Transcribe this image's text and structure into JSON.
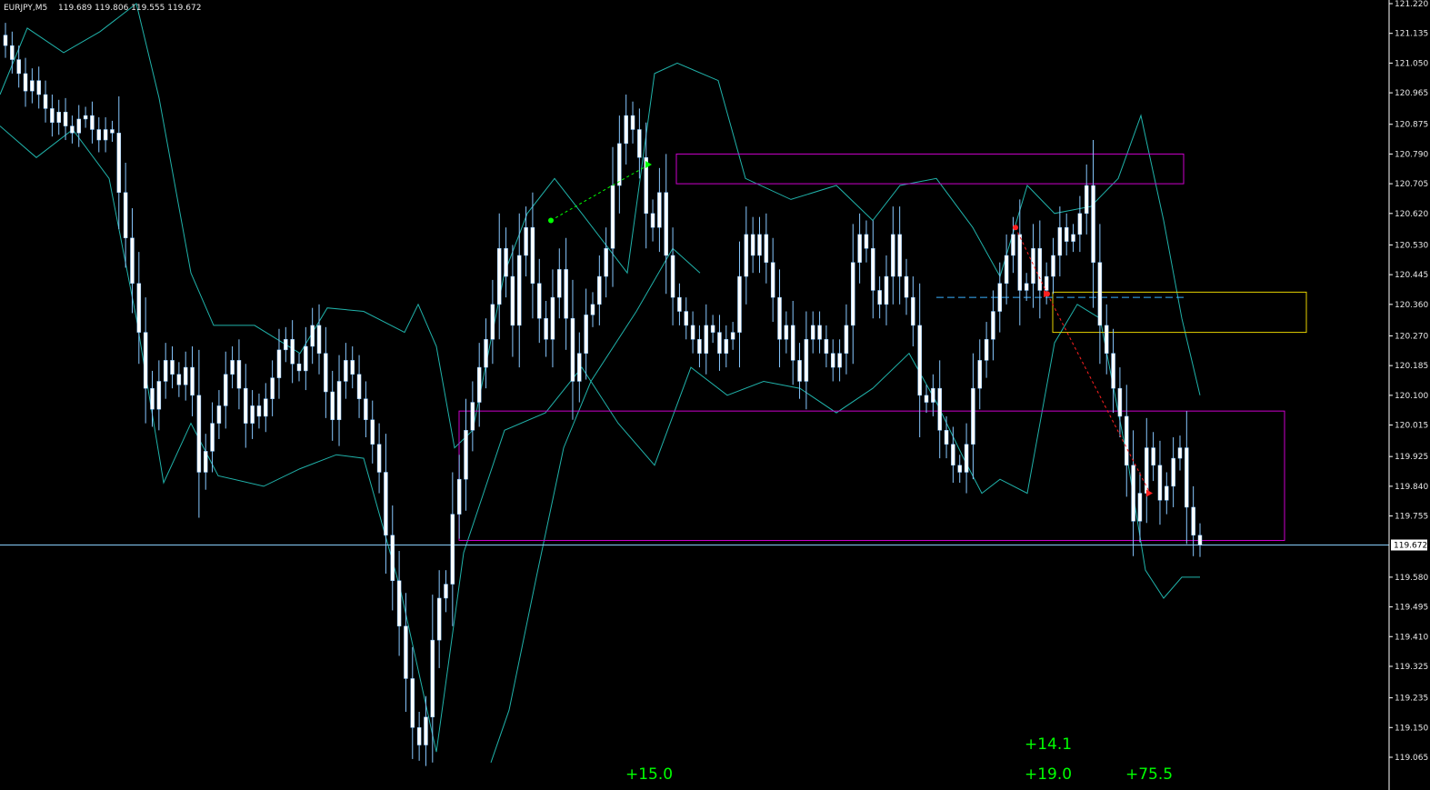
{
  "header": {
    "symbol": "EURJPY,M5",
    "ohlc": "119.689 119.806 119.555 119.672"
  },
  "colors": {
    "background": "#000000",
    "candle_up": "#ffffff",
    "candle_down": "#ffffff",
    "wick": "#87c7ff",
    "bollinger": "#20b2aa",
    "zone_magenta": "#cc00cc",
    "zone_yellow": "#e6d200",
    "trade_buy": "#00ff00",
    "trade_sell": "#ff2020",
    "current_price_line": "#87cefa",
    "profit_text": "#00ff00"
  },
  "chart_data": {
    "type": "candlestick",
    "symbol": "EURJPY",
    "timeframe": "M5",
    "yrange": [
      119.065,
      121.22
    ],
    "y_ticks": [
      "121.220",
      "121.135",
      "121.050",
      "120.965",
      "120.875",
      "120.790",
      "120.705",
      "120.620",
      "120.530",
      "120.445",
      "120.360",
      "120.270",
      "120.185",
      "120.100",
      "120.015",
      "119.925",
      "119.840",
      "119.755",
      "119.672",
      "119.580",
      "119.495",
      "119.410",
      "119.325",
      "119.235",
      "119.150",
      "119.065"
    ],
    "current_price": 119.672,
    "closes": [
      121.1,
      121.06,
      121.02,
      120.97,
      121.0,
      120.96,
      120.92,
      120.88,
      120.91,
      120.87,
      120.85,
      120.89,
      120.9,
      120.86,
      120.83,
      120.86,
      120.85,
      120.68,
      120.55,
      120.42,
      120.28,
      120.12,
      120.06,
      120.14,
      120.2,
      120.16,
      120.13,
      120.18,
      120.1,
      119.88,
      119.94,
      120.02,
      120.07,
      120.16,
      120.2,
      120.12,
      120.02,
      120.07,
      120.04,
      120.09,
      120.15,
      120.23,
      120.26,
      120.19,
      120.17,
      120.24,
      120.3,
      120.22,
      120.11,
      120.03,
      120.14,
      120.2,
      120.16,
      120.09,
      120.03,
      119.96,
      119.88,
      119.7,
      119.57,
      119.44,
      119.29,
      119.15,
      119.1,
      119.18,
      119.4,
      119.52,
      119.56,
      119.76,
      119.86,
      120.0,
      120.08,
      120.18,
      120.26,
      120.36,
      120.52,
      120.44,
      120.3,
      120.5,
      120.58,
      120.42,
      120.32,
      120.26,
      120.38,
      120.46,
      120.32,
      120.14,
      120.22,
      120.33,
      120.36,
      120.44,
      120.52,
      120.7,
      120.82,
      120.9,
      120.86,
      120.78,
      120.62,
      120.58,
      120.68,
      120.5,
      120.38,
      120.34,
      120.3,
      120.26,
      120.22,
      120.3,
      120.28,
      120.22,
      120.26,
      120.28,
      120.44,
      120.56,
      120.5,
      120.56,
      120.48,
      120.38,
      120.26,
      120.3,
      120.2,
      120.14,
      120.26,
      120.3,
      120.26,
      120.22,
      120.18,
      120.22,
      120.3,
      120.48,
      120.56,
      120.52,
      120.4,
      120.36,
      120.44,
      120.56,
      120.44,
      120.38,
      120.3,
      120.1,
      120.08,
      120.12,
      120.0,
      119.96,
      119.9,
      119.88,
      119.96,
      120.12,
      120.2,
      120.26,
      120.34,
      120.42,
      120.5,
      120.56,
      120.4,
      120.42,
      120.52,
      120.4,
      120.44,
      120.5,
      120.58,
      120.54,
      120.56,
      120.62,
      120.7,
      120.48,
      120.3,
      120.22,
      120.12,
      120.04,
      119.9,
      119.74,
      119.82,
      119.95,
      119.9,
      119.8,
      119.84,
      119.92,
      119.95,
      119.78,
      119.7,
      119.672
    ]
  },
  "bollinger": {
    "upper": [
      [
        0,
        120.96
      ],
      [
        30,
        121.15
      ],
      [
        70,
        121.08
      ],
      [
        110,
        121.14
      ],
      [
        150,
        121.22
      ],
      [
        175,
        120.95
      ],
      [
        210,
        120.45
      ],
      [
        235,
        120.3
      ],
      [
        280,
        120.3
      ],
      [
        330,
        120.22
      ],
      [
        360,
        120.35
      ],
      [
        400,
        120.34
      ],
      [
        445,
        120.28
      ],
      [
        460,
        120.36
      ],
      [
        480,
        120.24
      ],
      [
        500,
        119.95
      ],
      [
        520,
        120.0
      ],
      [
        555,
        120.45
      ],
      [
        580,
        120.62
      ],
      [
        610,
        120.72
      ],
      [
        640,
        120.62
      ],
      [
        690,
        120.45
      ],
      [
        720,
        121.02
      ],
      [
        745,
        121.05
      ],
      [
        790,
        121.0
      ],
      [
        820,
        120.72
      ],
      [
        870,
        120.66
      ],
      [
        920,
        120.7
      ],
      [
        960,
        120.6
      ],
      [
        990,
        120.7
      ],
      [
        1030,
        120.72
      ],
      [
        1070,
        120.58
      ],
      [
        1100,
        120.44
      ],
      [
        1130,
        120.7
      ],
      [
        1160,
        120.62
      ],
      [
        1200,
        120.64
      ],
      [
        1230,
        120.72
      ],
      [
        1255,
        120.9
      ],
      [
        1280,
        120.6
      ],
      [
        1300,
        120.32
      ],
      [
        1320,
        120.1
      ]
    ],
    "lower": [
      [
        0,
        120.87
      ],
      [
        40,
        120.78
      ],
      [
        80,
        120.86
      ],
      [
        120,
        120.72
      ],
      [
        150,
        120.32
      ],
      [
        180,
        119.85
      ],
      [
        210,
        120.02
      ],
      [
        240,
        119.87
      ],
      [
        290,
        119.84
      ],
      [
        330,
        119.89
      ],
      [
        370,
        119.93
      ],
      [
        400,
        119.92
      ],
      [
        440,
        119.55
      ],
      [
        480,
        119.08
      ],
      [
        510,
        119.65
      ],
      [
        555,
        120.0
      ],
      [
        600,
        120.05
      ],
      [
        640,
        120.18
      ],
      [
        680,
        120.02
      ],
      [
        720,
        119.9
      ],
      [
        760,
        120.18
      ],
      [
        800,
        120.1
      ],
      [
        840,
        120.14
      ],
      [
        880,
        120.12
      ],
      [
        920,
        120.05
      ],
      [
        960,
        120.12
      ],
      [
        1000,
        120.22
      ],
      [
        1030,
        120.08
      ],
      [
        1060,
        119.92
      ],
      [
        1080,
        119.82
      ],
      [
        1100,
        119.86
      ],
      [
        1130,
        119.82
      ],
      [
        1160,
        120.25
      ],
      [
        1185,
        120.36
      ],
      [
        1210,
        120.32
      ],
      [
        1240,
        119.92
      ],
      [
        1260,
        119.6
      ],
      [
        1280,
        119.52
      ],
      [
        1300,
        119.58
      ],
      [
        1320,
        119.58
      ]
    ],
    "middle": [
      [
        540,
        119.05
      ],
      [
        560,
        119.2
      ],
      [
        590,
        119.58
      ],
      [
        620,
        119.95
      ],
      [
        650,
        120.14
      ],
      [
        700,
        120.34
      ],
      [
        740,
        120.52
      ],
      [
        770,
        120.45
      ]
    ]
  },
  "zones": [
    {
      "color": "magenta",
      "x0": 744,
      "x1": 1302,
      "top": 120.79,
      "bottom": 120.705
    },
    {
      "color": "magenta",
      "x0": 505,
      "x1": 1413,
      "top": 120.055,
      "bottom": 119.685
    },
    {
      "color": "yellow",
      "x0": 1158,
      "x1": 1437,
      "top": 120.395,
      "bottom": 120.28
    }
  ],
  "trades": [
    {
      "side": "buy",
      "x0": 606,
      "p0": 120.6,
      "x1": 714,
      "p1": 120.76
    },
    {
      "side": "sell",
      "x0": 1117,
      "p0": 120.58,
      "x1": 1152,
      "p1": 120.39
    },
    {
      "side": "sell",
      "x0": 1152,
      "p0": 120.39,
      "x1": 1265,
      "p1": 119.82
    }
  ],
  "level_lines": [
    {
      "x0": 1030,
      "x1": 1302,
      "price": 120.38
    }
  ],
  "profits": [
    {
      "text": "+15.0",
      "x": 688,
      "y": 857
    },
    {
      "text": "+14.1",
      "x": 1127,
      "y": 824
    },
    {
      "text": "+19.0",
      "x": 1127,
      "y": 857
    },
    {
      "text": "+75.5",
      "x": 1238,
      "y": 857
    }
  ]
}
